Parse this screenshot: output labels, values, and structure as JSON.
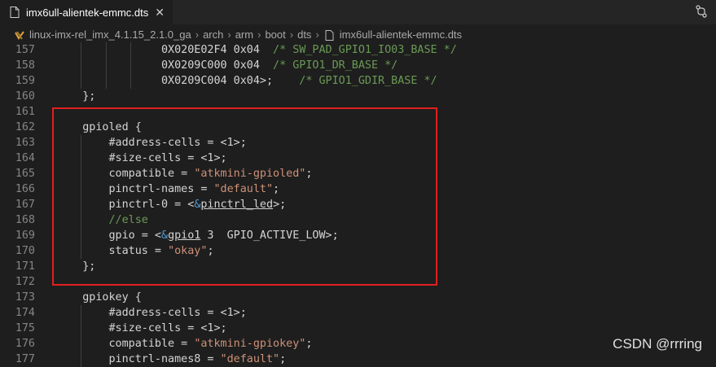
{
  "tab": {
    "filename": "imx6ull-alientek-emmc.dts",
    "close_glyph": "✕"
  },
  "breadcrumb": {
    "items": [
      "linux-imx-rel_imx_4.1.15_2.1.0_ga",
      "arch",
      "arm",
      "boot",
      "dts",
      "imx6ull-alientek-emmc.dts"
    ],
    "separator": "›"
  },
  "top_right_icon": "source-control-icon",
  "code_lines": [
    {
      "n": "157",
      "text": "                0X020E02F4 0x04  /* SW_PAD_GPIO1_IO03_BASE */"
    },
    {
      "n": "158",
      "text": "                0X0209C000 0x04  /* GPIO1_DR_BASE */"
    },
    {
      "n": "159",
      "text": "                0X0209C004 0x04>;    /* GPIO1_GDIR_BASE */"
    },
    {
      "n": "160",
      "text": "    };"
    },
    {
      "n": "161",
      "text": ""
    },
    {
      "n": "162",
      "text": "    gpioled {"
    },
    {
      "n": "163",
      "text": "        #address-cells = <1>;"
    },
    {
      "n": "164",
      "text": "        #size-cells = <1>;"
    },
    {
      "n": "165",
      "text": "        compatible = \"atkmini-gpioled\";"
    },
    {
      "n": "166",
      "text": "        pinctrl-names = \"default\";"
    },
    {
      "n": "167",
      "text": "        pinctrl-0 = <&pinctrl_led>;"
    },
    {
      "n": "168",
      "text": "        //else"
    },
    {
      "n": "169",
      "text": "        gpio = <&gpio1 3  GPIO_ACTIVE_LOW>;"
    },
    {
      "n": "170",
      "text": "        status = \"okay\";"
    },
    {
      "n": "171",
      "text": "    };"
    },
    {
      "n": "172",
      "text": ""
    },
    {
      "n": "173",
      "text": "    gpiokey {"
    },
    {
      "n": "174",
      "text": "        #address-cells = <1>;"
    },
    {
      "n": "175",
      "text": "        #size-cells = <1>;"
    },
    {
      "n": "176",
      "text": "        compatible = \"atkmini-gpiokey\";"
    },
    {
      "n": "177",
      "text": "        pinctrl-names8 = \"default\";"
    }
  ],
  "watermark": "CSDN @rrring",
  "colors": {
    "annotation_box": "#e02020",
    "string": "#ce9178",
    "comment": "#6a9955",
    "background": "#1e1e1e"
  }
}
